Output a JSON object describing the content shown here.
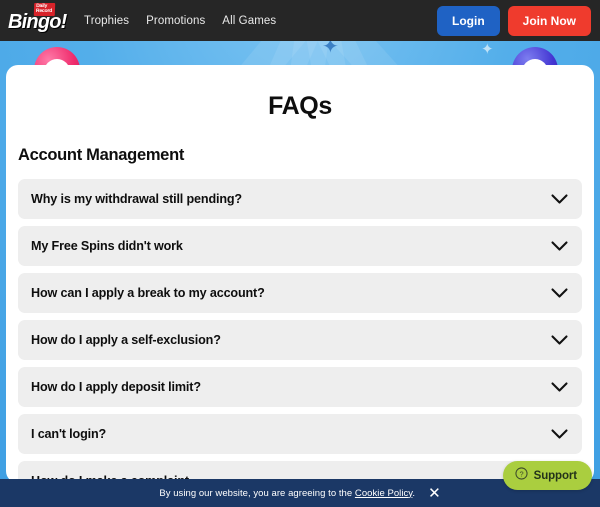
{
  "header": {
    "logo": {
      "badge_line1": "Daily",
      "badge_line2": "Record",
      "wordmark": "Bingo!"
    },
    "nav": [
      {
        "label": "Trophies"
      },
      {
        "label": "Promotions"
      },
      {
        "label": "All Games"
      }
    ],
    "login_label": "Login",
    "join_label": "Join Now",
    "colors": {
      "bar": "#262626",
      "login": "#1f62c4",
      "join": "#ef3b2d"
    }
  },
  "hero": {
    "background_color": "#4aa8e8",
    "ball_left_color": "#ef2d6d",
    "ball_right_color": "#4436d2",
    "star_icon": "star-icon"
  },
  "card": {
    "title": "FAQs",
    "section_title": "Account Management",
    "faqs": [
      {
        "question": "Why is my withdrawal still pending?",
        "icon": "chevron-down-icon",
        "expanded": false
      },
      {
        "question": "My Free Spins didn't work",
        "icon": "chevron-down-icon",
        "expanded": false
      },
      {
        "question": "How can I apply a break to my account?",
        "icon": "chevron-down-icon",
        "expanded": false
      },
      {
        "question": "How do I apply a self-exclusion?",
        "icon": "chevron-down-icon",
        "expanded": false
      },
      {
        "question": "How do I apply deposit limit?",
        "icon": "chevron-down-icon",
        "expanded": false
      },
      {
        "question": "I can't login?",
        "icon": "chevron-down-icon",
        "expanded": false
      },
      {
        "question": "How do I make a complaint",
        "icon": "chevron-down-icon",
        "expanded": false
      }
    ]
  },
  "cookie_bar": {
    "text_before": "By using our website, you are agreeing to the ",
    "link_label": "Cookie Policy",
    "text_after": ".",
    "close_icon": "close-icon",
    "close_glyph": "✕",
    "background_color": "#1b3866"
  },
  "support": {
    "label": "Support",
    "icon": "question-mark-circle-icon",
    "background_color": "#aace3f"
  }
}
